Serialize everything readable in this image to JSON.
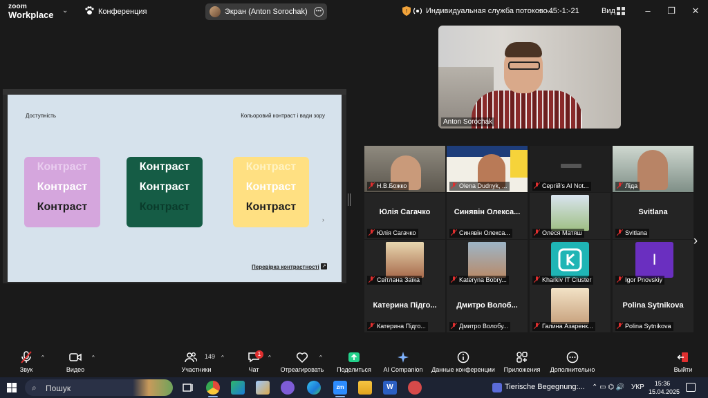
{
  "app": {
    "logo_line1": "zoom",
    "logo_line2": "Workplace"
  },
  "titlebar": {
    "conference_label": "Конференция",
    "screen_share_label": "Экран (Anton Sorochak)",
    "stream_label": "Индивидуальная служба потоково...",
    "timer": "-45:-1:-21",
    "view_label": "Вид"
  },
  "slide": {
    "left_heading": "Доступність",
    "right_heading": "Кольоровий контраст і вади зору",
    "cards": [
      {
        "bg": "#d5a6dd",
        "rows": [
          {
            "text": "Контраст",
            "color": "#e9cdef"
          },
          {
            "text": "Контраст",
            "color": "#ffffff"
          },
          {
            "text": "Контраст",
            "color": "#1f1f1f"
          }
        ]
      },
      {
        "bg": "#155c45",
        "rows": [
          {
            "text": "Контраст",
            "color": "#ffffff"
          },
          {
            "text": "Контраст",
            "color": "#ffffff"
          },
          {
            "text": "Контраст",
            "color": "#0a3b2b"
          }
        ]
      },
      {
        "bg": "#ffe082",
        "rows": [
          {
            "text": "Контраст",
            "color": "#fff3c4"
          },
          {
            "text": "Контраст",
            "color": "#ffffff"
          },
          {
            "text": "Контраст",
            "color": "#1f1f1f"
          }
        ]
      }
    ],
    "arrow": "›",
    "link": "Перевірка контрастності"
  },
  "speaker": {
    "name": "Anton Sorochak"
  },
  "gallery": {
    "row1": [
      {
        "label": "Н.В.Божко"
      },
      {
        "label": "Olena Dudnyk, ..."
      },
      {
        "label": "Сергій's AI Not..."
      },
      {
        "label": "Ліда"
      }
    ],
    "row2": [
      {
        "big": "Юлія Сагачко",
        "label": "Юлія Сагачко"
      },
      {
        "big": "Синявін Олекса...",
        "label": "Синявін Олекса..."
      },
      {
        "big": "",
        "label": "Олеся Матяш"
      },
      {
        "big": "Svitlana",
        "label": "Svitlana"
      }
    ],
    "row3": [
      {
        "label": "Світлана Заїка"
      },
      {
        "label": "Kateryna Bobry..."
      },
      {
        "label": "Kharkiv IT Cluster"
      },
      {
        "label": "Igor Pnovskiy",
        "avatar_letter": "I"
      }
    ],
    "row4": [
      {
        "big": "Катерина Підго...",
        "label": "Катерина Підго..."
      },
      {
        "big": "Дмитро Волоб...",
        "label": "Дмитро Волобу..."
      },
      {
        "big": "",
        "label": "Галина Азаренк..."
      },
      {
        "big": "Polina Sytnikova",
        "label": "Polina Sytnikova"
      }
    ]
  },
  "toolbar": {
    "audio": "Звук",
    "video": "Видео",
    "participants": "Участники",
    "participants_count": "149",
    "chat": "Чат",
    "chat_badge": "1",
    "react": "Отреагировать",
    "share": "Поделиться",
    "ai": "AI Companion",
    "info": "Данные конференции",
    "apps": "Приложения",
    "more": "Дополнительно",
    "leave": "Выйти"
  },
  "taskbar": {
    "search_placeholder": "Пошук",
    "media_title": "Tierische Begegnung:...",
    "lang": "УКР",
    "time": "15:36",
    "date": "15.04.2025"
  },
  "colors": {
    "accent": "#0b5cff",
    "muted_red": "#e02f2f",
    "green_share": "#23d18b"
  }
}
